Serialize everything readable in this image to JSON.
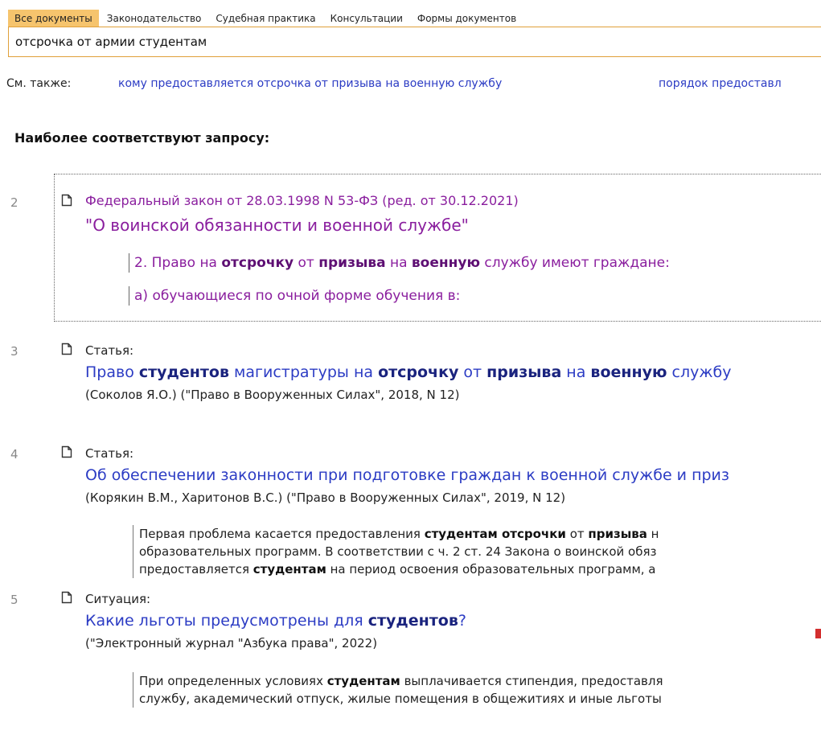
{
  "tabs": [
    "Все документы",
    "Законодательство",
    "Судебная практика",
    "Консультации",
    "Формы документов"
  ],
  "search": {
    "value": "отсрочка от армии студентам"
  },
  "see_also": {
    "label": "См. также:",
    "links": [
      "кому предоставляется отсрочка от призыва на военную службу",
      "порядок предоставл"
    ]
  },
  "best_heading": "Наиболее соответствуют запросу:",
  "result2": {
    "num": "2",
    "title_line1": "Федеральный закон от 28.03.1998 N 53-ФЗ (ред. от 30.12.2021)",
    "title_line2": "\"О воинской обязанности и военной службе\"",
    "snip1": {
      "a": "2. Право на ",
      "b": "отсрочку",
      "c": " от ",
      "d": "призыва",
      "e": " на ",
      "f": "военную",
      "g": " службу имеют граждане:"
    },
    "snip2": "а) обучающиеся по очной форме обучения в:"
  },
  "result3": {
    "num": "3",
    "type": "Статья:",
    "title": {
      "a": "Право ",
      "b": "студентов",
      "c": " магистратуры на ",
      "d": "отсрочку",
      "e": " от ",
      "f": "призыва",
      "g": " на ",
      "h": "военную",
      "i": " службу"
    },
    "source": "(Соколов Я.О.) (\"Право в Вооруженных Силах\", 2018, N 12)"
  },
  "result4": {
    "num": "4",
    "type": "Статья:",
    "title": "Об обеспечении законности при подготовке граждан к военной службе и приз",
    "source": "(Корякин В.М., Харитонов В.С.) (\"Право в Вооруженных Силах\", 2019, N 12)",
    "snip_l1": {
      "a": "Первая проблема касается предоставления ",
      "b": "студентам отсрочки",
      "c": " от ",
      "d": "призыва",
      "e": " н"
    },
    "snip_l2": "образовательных программ. В соответствии с ч. 2 ст. 24 Закона о воинской обяз",
    "snip_l3": {
      "a": "предоставляется ",
      "b": "студентам",
      "c": " на период освоения образовательных программ, а"
    }
  },
  "result5": {
    "num": "5",
    "type": "Ситуация:",
    "title": {
      "a": "Какие льготы предусмотрены для ",
      "b": "студентов",
      "c": "?"
    },
    "source": "(\"Электронный журнал \"Азбука права\", 2022)",
    "snip_l1": {
      "a": "При определенных условиях ",
      "b": "студентам",
      "c": " выплачивается стипендия, предоставля"
    },
    "snip_l2": "службу, академический отпуск, жилые помещения в общежитиях и иные льготы"
  }
}
